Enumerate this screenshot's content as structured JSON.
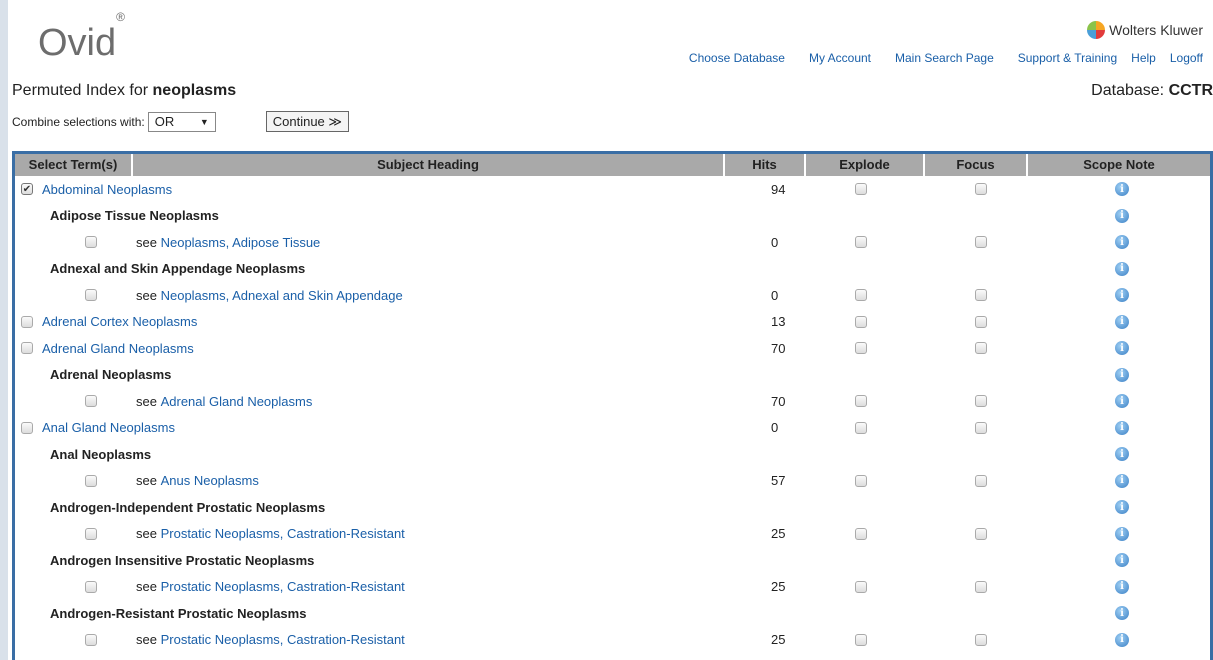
{
  "header": {
    "logo": "Ovid",
    "logo_mark": "®",
    "brand": "Wolters Kluwer",
    "nav": [
      "Choose Database",
      "My Account",
      "Main Search Page",
      "Support & Training",
      "Help",
      "Logoff"
    ]
  },
  "title": {
    "prefix": "Permuted Index for",
    "term": "neoplasms"
  },
  "database": {
    "label": "Database:",
    "value": "CCTR"
  },
  "combine": {
    "label": "Combine selections with:",
    "selected": "OR",
    "continue_label": "Continue ≫"
  },
  "columns": [
    "Select Term(s)",
    "Subject Heading",
    "Hits",
    "Explode",
    "Focus",
    "Scope Note"
  ],
  "rows": [
    {
      "kind": "term",
      "checked": true,
      "label": "Abdominal Neoplasms",
      "hits": "94"
    },
    {
      "kind": "heading",
      "label": "Adipose Tissue Neoplasms"
    },
    {
      "kind": "see",
      "see": "see",
      "label": "Neoplasms, Adipose Tissue",
      "hits": "0"
    },
    {
      "kind": "heading",
      "label": "Adnexal and Skin Appendage Neoplasms"
    },
    {
      "kind": "see",
      "see": "see",
      "label": "Neoplasms, Adnexal and Skin Appendage",
      "hits": "0"
    },
    {
      "kind": "term",
      "checked": false,
      "label": "Adrenal Cortex Neoplasms",
      "hits": "13"
    },
    {
      "kind": "term",
      "checked": false,
      "label": "Adrenal Gland Neoplasms",
      "hits": "70"
    },
    {
      "kind": "heading",
      "label": "Adrenal Neoplasms"
    },
    {
      "kind": "see",
      "see": "see",
      "label": "Adrenal Gland Neoplasms",
      "hits": "70"
    },
    {
      "kind": "term",
      "checked": false,
      "label": "Anal Gland Neoplasms",
      "hits": "0"
    },
    {
      "kind": "heading",
      "label": "Anal Neoplasms"
    },
    {
      "kind": "see",
      "see": "see",
      "label": "Anus Neoplasms",
      "hits": "57"
    },
    {
      "kind": "heading",
      "label": "Androgen-Independent Prostatic Neoplasms"
    },
    {
      "kind": "see",
      "see": "see",
      "label": "Prostatic Neoplasms, Castration-Resistant",
      "hits": "25"
    },
    {
      "kind": "heading",
      "label": "Androgen Insensitive Prostatic Neoplasms"
    },
    {
      "kind": "see",
      "see": "see",
      "label": "Prostatic Neoplasms, Castration-Resistant",
      "hits": "25"
    },
    {
      "kind": "heading",
      "label": "Androgen-Resistant Prostatic Neoplasms"
    },
    {
      "kind": "see",
      "see": "see",
      "label": "Prostatic Neoplasms, Castration-Resistant",
      "hits": "25"
    }
  ],
  "colors": {
    "link": "#1a5fa8",
    "table_border": "#3a6ea5",
    "header_bg": "#a9a9a9"
  }
}
